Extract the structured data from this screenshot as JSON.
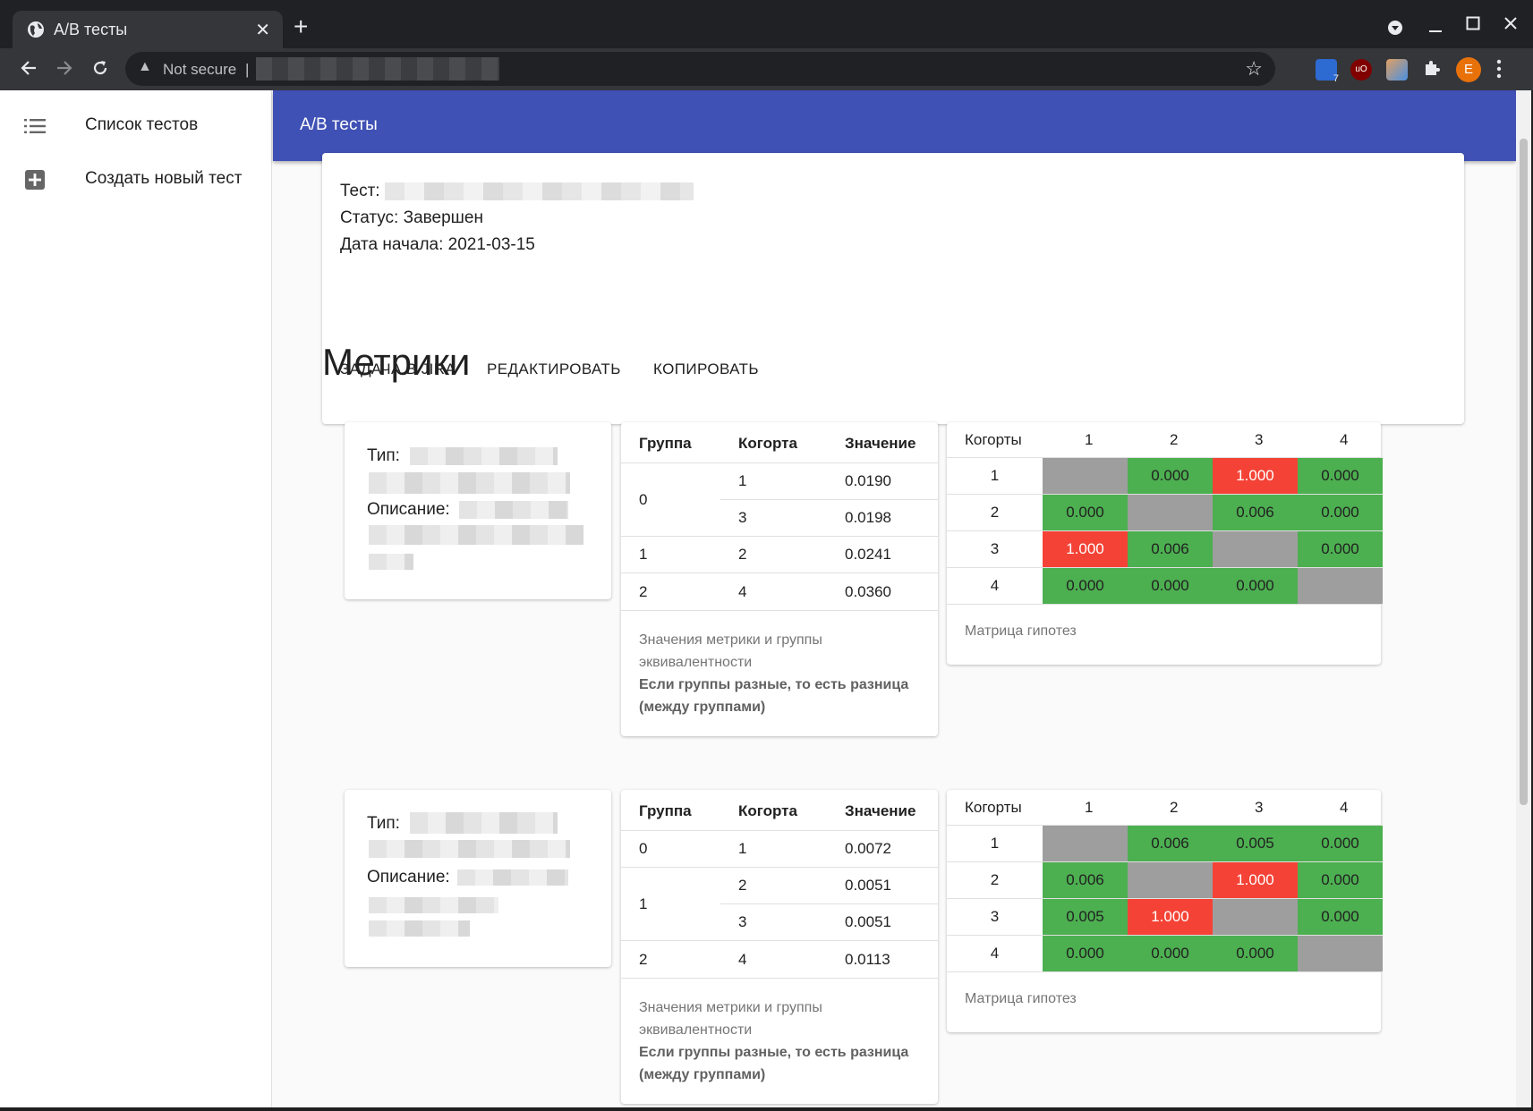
{
  "browser": {
    "tab_title": "A/B тесты",
    "tab_close": "✕",
    "new_tab": "+",
    "security_text": "Not secure",
    "security_sep": "|",
    "profile_initial": "E",
    "ext_badge": "7",
    "ext_ublock": "uO"
  },
  "sidebar": {
    "items": [
      {
        "label": "Список тестов",
        "icon": "list-icon"
      },
      {
        "label": "Создать новый тест",
        "icon": "add-box-icon"
      }
    ]
  },
  "appbar": {
    "title": "A/B тесты"
  },
  "test": {
    "name_label": "Тест:",
    "status_line": "Статус: Завершен",
    "date_line": "Дата начала: 2021-03-15",
    "actions": [
      "ЗАДАЧА В JIRA",
      "РЕДАКТИРОВАТЬ",
      "КОПИРОВАТЬ"
    ]
  },
  "metrics_heading": "Метрики",
  "labels": {
    "type": "Тип:",
    "description": "Описание:",
    "col_group": "Группа",
    "col_cohort": "Когорта",
    "col_value": "Значение",
    "table_caption": "Значения метрики и группы эквивалентности",
    "table_note": "Если группы разные, то есть разница (между группами)",
    "matrix_cohorts": "Когорты",
    "matrix_caption": "Матрица гипотез"
  },
  "colors": {
    "green": "#4caf50",
    "red": "#f44336",
    "gray": "#9e9e9e",
    "appbar": "#3f51b5"
  },
  "metrics": [
    {
      "groups": [
        {
          "group": "0",
          "rows": [
            {
              "cohort": "1",
              "value": "0.0190"
            },
            {
              "cohort": "3",
              "value": "0.0198"
            }
          ]
        },
        {
          "group": "1",
          "rows": [
            {
              "cohort": "2",
              "value": "0.0241"
            }
          ]
        },
        {
          "group": "2",
          "rows": [
            {
              "cohort": "4",
              "value": "0.0360"
            }
          ]
        }
      ],
      "matrix": {
        "cols": [
          "1",
          "2",
          "3",
          "4"
        ],
        "rows": [
          {
            "label": "1",
            "cells": [
              {
                "v": "",
                "c": "gray"
              },
              {
                "v": "0.000",
                "c": "green"
              },
              {
                "v": "1.000",
                "c": "red"
              },
              {
                "v": "0.000",
                "c": "green"
              }
            ]
          },
          {
            "label": "2",
            "cells": [
              {
                "v": "0.000",
                "c": "green"
              },
              {
                "v": "",
                "c": "gray"
              },
              {
                "v": "0.006",
                "c": "green"
              },
              {
                "v": "0.000",
                "c": "green"
              }
            ]
          },
          {
            "label": "3",
            "cells": [
              {
                "v": "1.000",
                "c": "red"
              },
              {
                "v": "0.006",
                "c": "green"
              },
              {
                "v": "",
                "c": "gray"
              },
              {
                "v": "0.000",
                "c": "green"
              }
            ]
          },
          {
            "label": "4",
            "cells": [
              {
                "v": "0.000",
                "c": "green"
              },
              {
                "v": "0.000",
                "c": "green"
              },
              {
                "v": "0.000",
                "c": "green"
              },
              {
                "v": "",
                "c": "gray"
              }
            ]
          }
        ]
      }
    },
    {
      "groups": [
        {
          "group": "0",
          "rows": [
            {
              "cohort": "1",
              "value": "0.0072"
            }
          ]
        },
        {
          "group": "1",
          "rows": [
            {
              "cohort": "2",
              "value": "0.0051"
            },
            {
              "cohort": "3",
              "value": "0.0051"
            }
          ]
        },
        {
          "group": "2",
          "rows": [
            {
              "cohort": "4",
              "value": "0.0113"
            }
          ]
        }
      ],
      "matrix": {
        "cols": [
          "1",
          "2",
          "3",
          "4"
        ],
        "rows": [
          {
            "label": "1",
            "cells": [
              {
                "v": "",
                "c": "gray"
              },
              {
                "v": "0.006",
                "c": "green"
              },
              {
                "v": "0.005",
                "c": "green"
              },
              {
                "v": "0.000",
                "c": "green"
              }
            ]
          },
          {
            "label": "2",
            "cells": [
              {
                "v": "0.006",
                "c": "green"
              },
              {
                "v": "",
                "c": "gray"
              },
              {
                "v": "1.000",
                "c": "red"
              },
              {
                "v": "0.000",
                "c": "green"
              }
            ]
          },
          {
            "label": "3",
            "cells": [
              {
                "v": "0.005",
                "c": "green"
              },
              {
                "v": "1.000",
                "c": "red"
              },
              {
                "v": "",
                "c": "gray"
              },
              {
                "v": "0.000",
                "c": "green"
              }
            ]
          },
          {
            "label": "4",
            "cells": [
              {
                "v": "0.000",
                "c": "green"
              },
              {
                "v": "0.000",
                "c": "green"
              },
              {
                "v": "0.000",
                "c": "green"
              },
              {
                "v": "",
                "c": "gray"
              }
            ]
          }
        ]
      }
    }
  ]
}
